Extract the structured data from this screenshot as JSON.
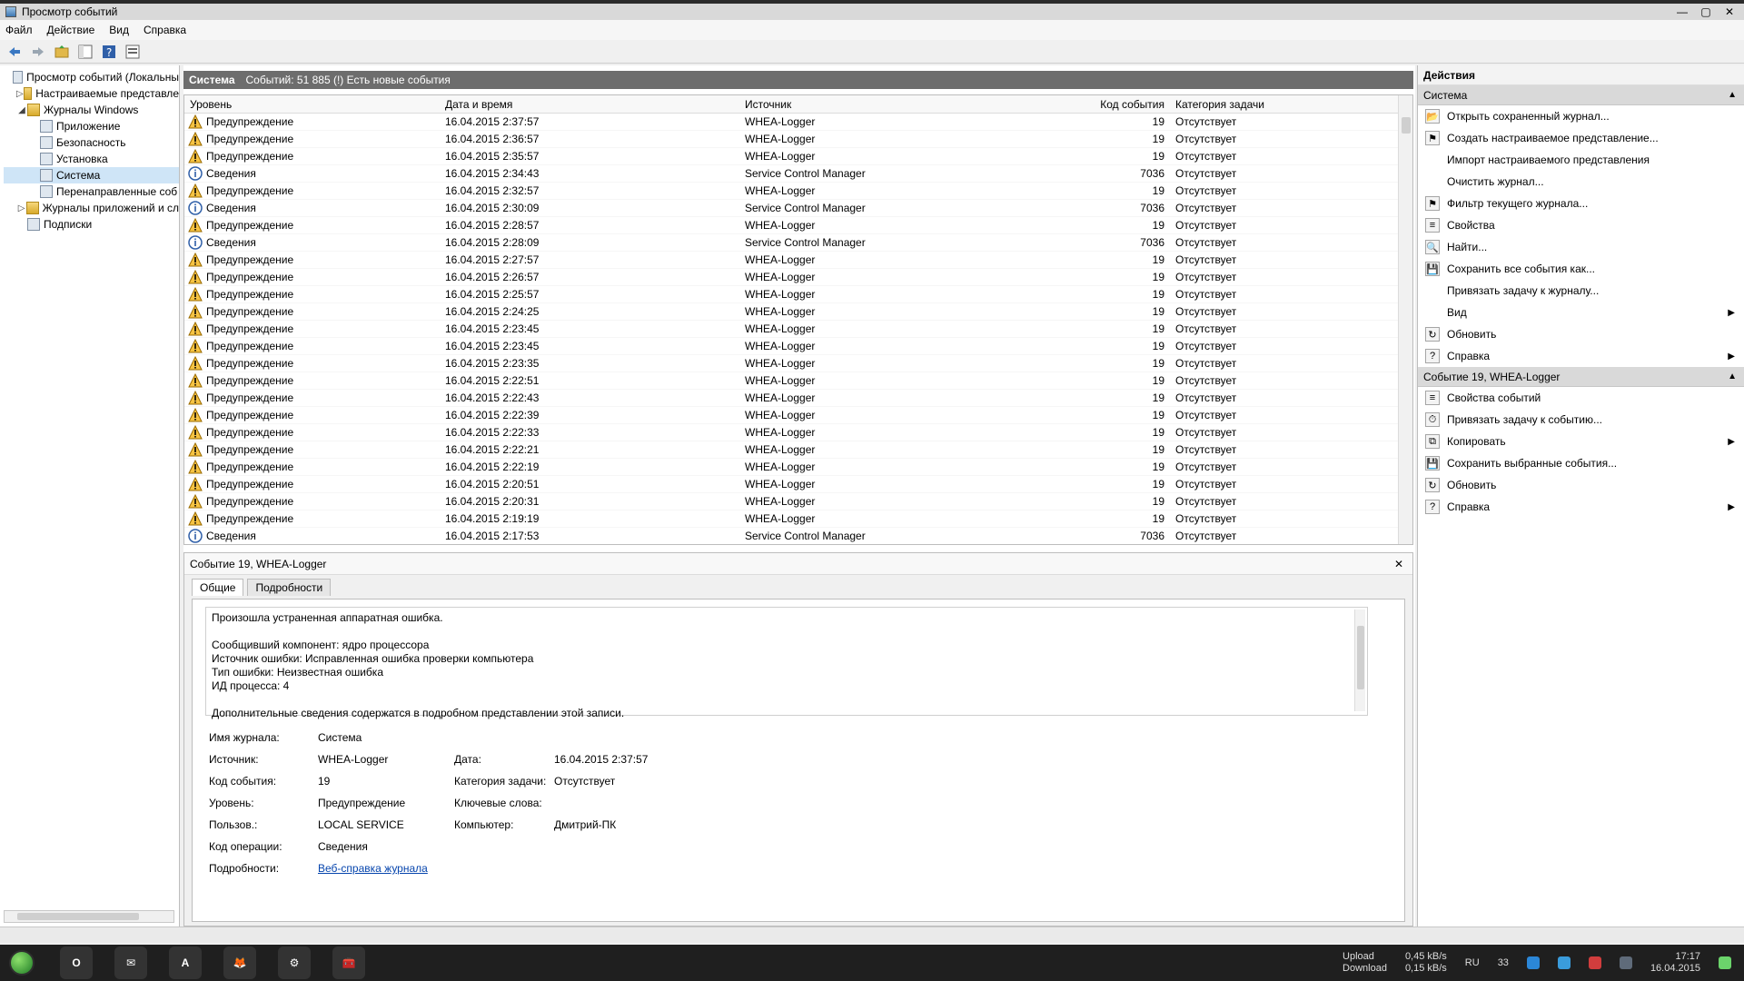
{
  "window": {
    "title": "Просмотр событий",
    "menu": [
      "Файл",
      "Действие",
      "Вид",
      "Справка"
    ]
  },
  "toolbar": {
    "icons": [
      "back-icon",
      "forward-icon",
      "up-folder-icon",
      "show-hide-tree-icon",
      "help-icon",
      "properties-icon"
    ]
  },
  "tree": {
    "items": [
      {
        "label": "Просмотр событий (Локальны",
        "level": 0,
        "icon": "event-viewer-icon",
        "toggle": "",
        "selected": false
      },
      {
        "label": "Настраиваемые представле",
        "level": 1,
        "icon": "folder-icon",
        "toggle": "▷",
        "selected": false
      },
      {
        "label": "Журналы Windows",
        "level": 1,
        "icon": "folder-icon",
        "toggle": "◢",
        "selected": false
      },
      {
        "label": "Приложение",
        "level": 2,
        "icon": "log-icon",
        "toggle": "",
        "selected": false
      },
      {
        "label": "Безопасность",
        "level": 2,
        "icon": "log-icon",
        "toggle": "",
        "selected": false
      },
      {
        "label": "Установка",
        "level": 2,
        "icon": "log-icon",
        "toggle": "",
        "selected": false
      },
      {
        "label": "Система",
        "level": 2,
        "icon": "log-icon",
        "toggle": "",
        "selected": true
      },
      {
        "label": "Перенаправленные соб",
        "level": 2,
        "icon": "log-icon",
        "toggle": "",
        "selected": false
      },
      {
        "label": "Журналы приложений и сл",
        "level": 1,
        "icon": "folder-icon",
        "toggle": "▷",
        "selected": false
      },
      {
        "label": "Подписки",
        "level": 1,
        "icon": "subscriptions-icon",
        "toggle": "",
        "selected": false
      }
    ]
  },
  "center": {
    "header_name": "Система",
    "header_count": "Событий: 51 885 (!) Есть новые события",
    "columns": [
      "Уровень",
      "Дата и время",
      "Источник",
      "Код события",
      "Категория задачи"
    ],
    "rows": [
      {
        "level": "Предупреждение",
        "type": "warning",
        "datetime": "16.04.2015 2:37:57",
        "source": "WHEA-Logger",
        "id": "19",
        "category": "Отсутствует"
      },
      {
        "level": "Предупреждение",
        "type": "warning",
        "datetime": "16.04.2015 2:36:57",
        "source": "WHEA-Logger",
        "id": "19",
        "category": "Отсутствует"
      },
      {
        "level": "Предупреждение",
        "type": "warning",
        "datetime": "16.04.2015 2:35:57",
        "source": "WHEA-Logger",
        "id": "19",
        "category": "Отсутствует"
      },
      {
        "level": "Сведения",
        "type": "info",
        "datetime": "16.04.2015 2:34:43",
        "source": "Service Control Manager",
        "id": "7036",
        "category": "Отсутствует"
      },
      {
        "level": "Предупреждение",
        "type": "warning",
        "datetime": "16.04.2015 2:32:57",
        "source": "WHEA-Logger",
        "id": "19",
        "category": "Отсутствует"
      },
      {
        "level": "Сведения",
        "type": "info",
        "datetime": "16.04.2015 2:30:09",
        "source": "Service Control Manager",
        "id": "7036",
        "category": "Отсутствует"
      },
      {
        "level": "Предупреждение",
        "type": "warning",
        "datetime": "16.04.2015 2:28:57",
        "source": "WHEA-Logger",
        "id": "19",
        "category": "Отсутствует"
      },
      {
        "level": "Сведения",
        "type": "info",
        "datetime": "16.04.2015 2:28:09",
        "source": "Service Control Manager",
        "id": "7036",
        "category": "Отсутствует"
      },
      {
        "level": "Предупреждение",
        "type": "warning",
        "datetime": "16.04.2015 2:27:57",
        "source": "WHEA-Logger",
        "id": "19",
        "category": "Отсутствует"
      },
      {
        "level": "Предупреждение",
        "type": "warning",
        "datetime": "16.04.2015 2:26:57",
        "source": "WHEA-Logger",
        "id": "19",
        "category": "Отсутствует"
      },
      {
        "level": "Предупреждение",
        "type": "warning",
        "datetime": "16.04.2015 2:25:57",
        "source": "WHEA-Logger",
        "id": "19",
        "category": "Отсутствует"
      },
      {
        "level": "Предупреждение",
        "type": "warning",
        "datetime": "16.04.2015 2:24:25",
        "source": "WHEA-Logger",
        "id": "19",
        "category": "Отсутствует"
      },
      {
        "level": "Предупреждение",
        "type": "warning",
        "datetime": "16.04.2015 2:23:45",
        "source": "WHEA-Logger",
        "id": "19",
        "category": "Отсутствует"
      },
      {
        "level": "Предупреждение",
        "type": "warning",
        "datetime": "16.04.2015 2:23:45",
        "source": "WHEA-Logger",
        "id": "19",
        "category": "Отсутствует"
      },
      {
        "level": "Предупреждение",
        "type": "warning",
        "datetime": "16.04.2015 2:23:35",
        "source": "WHEA-Logger",
        "id": "19",
        "category": "Отсутствует"
      },
      {
        "level": "Предупреждение",
        "type": "warning",
        "datetime": "16.04.2015 2:22:51",
        "source": "WHEA-Logger",
        "id": "19",
        "category": "Отсутствует"
      },
      {
        "level": "Предупреждение",
        "type": "warning",
        "datetime": "16.04.2015 2:22:43",
        "source": "WHEA-Logger",
        "id": "19",
        "category": "Отсутствует"
      },
      {
        "level": "Предупреждение",
        "type": "warning",
        "datetime": "16.04.2015 2:22:39",
        "source": "WHEA-Logger",
        "id": "19",
        "category": "Отсутствует"
      },
      {
        "level": "Предупреждение",
        "type": "warning",
        "datetime": "16.04.2015 2:22:33",
        "source": "WHEA-Logger",
        "id": "19",
        "category": "Отсутствует"
      },
      {
        "level": "Предупреждение",
        "type": "warning",
        "datetime": "16.04.2015 2:22:21",
        "source": "WHEA-Logger",
        "id": "19",
        "category": "Отсутствует"
      },
      {
        "level": "Предупреждение",
        "type": "warning",
        "datetime": "16.04.2015 2:22:19",
        "source": "WHEA-Logger",
        "id": "19",
        "category": "Отсутствует"
      },
      {
        "level": "Предупреждение",
        "type": "warning",
        "datetime": "16.04.2015 2:20:51",
        "source": "WHEA-Logger",
        "id": "19",
        "category": "Отсутствует"
      },
      {
        "level": "Предупреждение",
        "type": "warning",
        "datetime": "16.04.2015 2:20:31",
        "source": "WHEA-Logger",
        "id": "19",
        "category": "Отсутствует"
      },
      {
        "level": "Предупреждение",
        "type": "warning",
        "datetime": "16.04.2015 2:19:19",
        "source": "WHEA-Logger",
        "id": "19",
        "category": "Отсутствует"
      },
      {
        "level": "Сведения",
        "type": "info",
        "datetime": "16.04.2015 2:17:53",
        "source": "Service Control Manager",
        "id": "7036",
        "category": "Отсутствует"
      }
    ]
  },
  "details": {
    "title": "Событие 19, WHEA-Logger",
    "tabs": [
      "Общие",
      "Подробности"
    ],
    "description_lines": [
      "Произошла устраненная аппаратная ошибка.",
      "",
      "Сообщивший компонент: ядро процессора",
      "Источник ошибки: Исправленная ошибка проверки компьютера",
      "Тип ошибки: Неизвестная ошибка",
      "ИД процесса: 4",
      "",
      "Дополнительные сведения содержатся в подробном представлении этой записи."
    ],
    "props": {
      "log_name_label": "Имя журнала:",
      "log_name": "Система",
      "source_label": "Источник:",
      "source": "WHEA-Logger",
      "date_label": "Дата:",
      "date": "16.04.2015 2:37:57",
      "event_id_label": "Код события:",
      "event_id": "19",
      "task_cat_label": "Категория задачи:",
      "task_cat": "Отсутствует",
      "level_label": "Уровень:",
      "level": "Предупреждение",
      "keywords_label": "Ключевые слова:",
      "keywords": "",
      "user_label": "Пользов.:",
      "user": "LOCAL SERVICE",
      "computer_label": "Компьютер:",
      "computer": "Дмитрий-ПК",
      "opcode_label": "Код операции:",
      "opcode": "Сведения",
      "more_label": "Подробности:",
      "more_link": "Веб-справка журнала"
    }
  },
  "actions": {
    "title": "Действия",
    "section1": "Система",
    "items1": [
      {
        "label": "Открыть сохраненный журнал...",
        "icon": "open-log-icon",
        "arrow": false
      },
      {
        "label": "Создать настраиваемое представление...",
        "icon": "filter-icon",
        "arrow": false
      },
      {
        "label": "Импорт настраиваемого представления",
        "icon": "",
        "arrow": false
      },
      {
        "label": "Очистить журнал...",
        "icon": "",
        "arrow": false
      },
      {
        "label": "Фильтр текущего журнала...",
        "icon": "filter-icon",
        "arrow": false
      },
      {
        "label": "Свойства",
        "icon": "properties-icon",
        "arrow": false
      },
      {
        "label": "Найти...",
        "icon": "find-icon",
        "arrow": false
      },
      {
        "label": "Сохранить все события как...",
        "icon": "save-icon",
        "arrow": false
      },
      {
        "label": "Привязать задачу к журналу...",
        "icon": "",
        "arrow": false
      },
      {
        "label": "Вид",
        "icon": "",
        "arrow": true
      },
      {
        "label": "Обновить",
        "icon": "refresh-icon",
        "arrow": false
      },
      {
        "label": "Справка",
        "icon": "help-icon",
        "arrow": true
      }
    ],
    "section2": "Событие 19, WHEA-Logger",
    "items2": [
      {
        "label": "Свойства событий",
        "icon": "event-properties-icon",
        "arrow": false
      },
      {
        "label": "Привязать задачу к событию...",
        "icon": "task-icon",
        "arrow": false
      },
      {
        "label": "Копировать",
        "icon": "copy-icon",
        "arrow": true
      },
      {
        "label": "Сохранить выбранные события...",
        "icon": "save-icon",
        "arrow": false
      },
      {
        "label": "Обновить",
        "icon": "refresh-icon",
        "arrow": false
      },
      {
        "label": "Справка",
        "icon": "help-icon",
        "arrow": true
      }
    ]
  },
  "taskbar": {
    "apps": [
      "O",
      "✉",
      "A",
      "🦊",
      "⚙",
      "🧰"
    ],
    "upload_label": "Upload",
    "download_label": "Download",
    "upload_speed": "0,45 kB/s",
    "download_speed": "0,15 kB/s",
    "lang": "RU",
    "time": "17:17",
    "date": "16.04.2015",
    "tray_count": "33"
  }
}
